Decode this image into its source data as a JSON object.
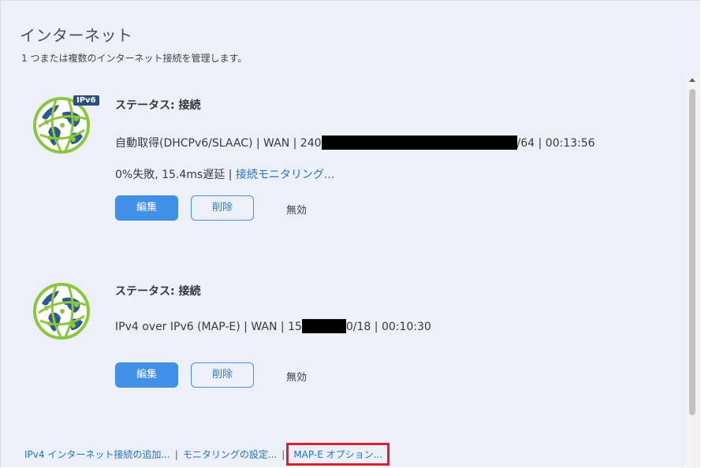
{
  "page": {
    "title": "インターネット",
    "subtitle": "1 つまたは複数のインターネット接続を管理します。"
  },
  "connections": [
    {
      "badge": "IPv6",
      "status": "ステータス: 接続",
      "detail_prefix": "自動取得(DHCPv6/SLAAC) | WAN | 240",
      "detail_suffix": "/64 | 00:13:56",
      "stats_text": "0%失敗, 15.4ms遅延 | ",
      "monitor_link": "接続モニタリング...",
      "edit_label": "編集",
      "delete_label": "削除",
      "disable_label": "無効"
    },
    {
      "status": "ステータス: 接続",
      "detail_prefix": "IPv4 over IPv6 (MAP-E) | WAN | 15",
      "detail_suffix": "0/18 | 00:10:30",
      "edit_label": "編集",
      "delete_label": "削除",
      "disable_label": "無効"
    }
  ],
  "footer": {
    "add_ipv4_link": "IPv4 インターネット接続の追加...",
    "monitoring_settings_link": "モニタリングの設定...",
    "mape_options_link": "MAP-E オプション...",
    "separator": "|"
  },
  "colors": {
    "accent": "#4291e9",
    "link": "#1f74c9",
    "highlight_border": "#e01e2d",
    "globe_green": "#8cc63f",
    "globe_blue": "#2d5a8c"
  }
}
